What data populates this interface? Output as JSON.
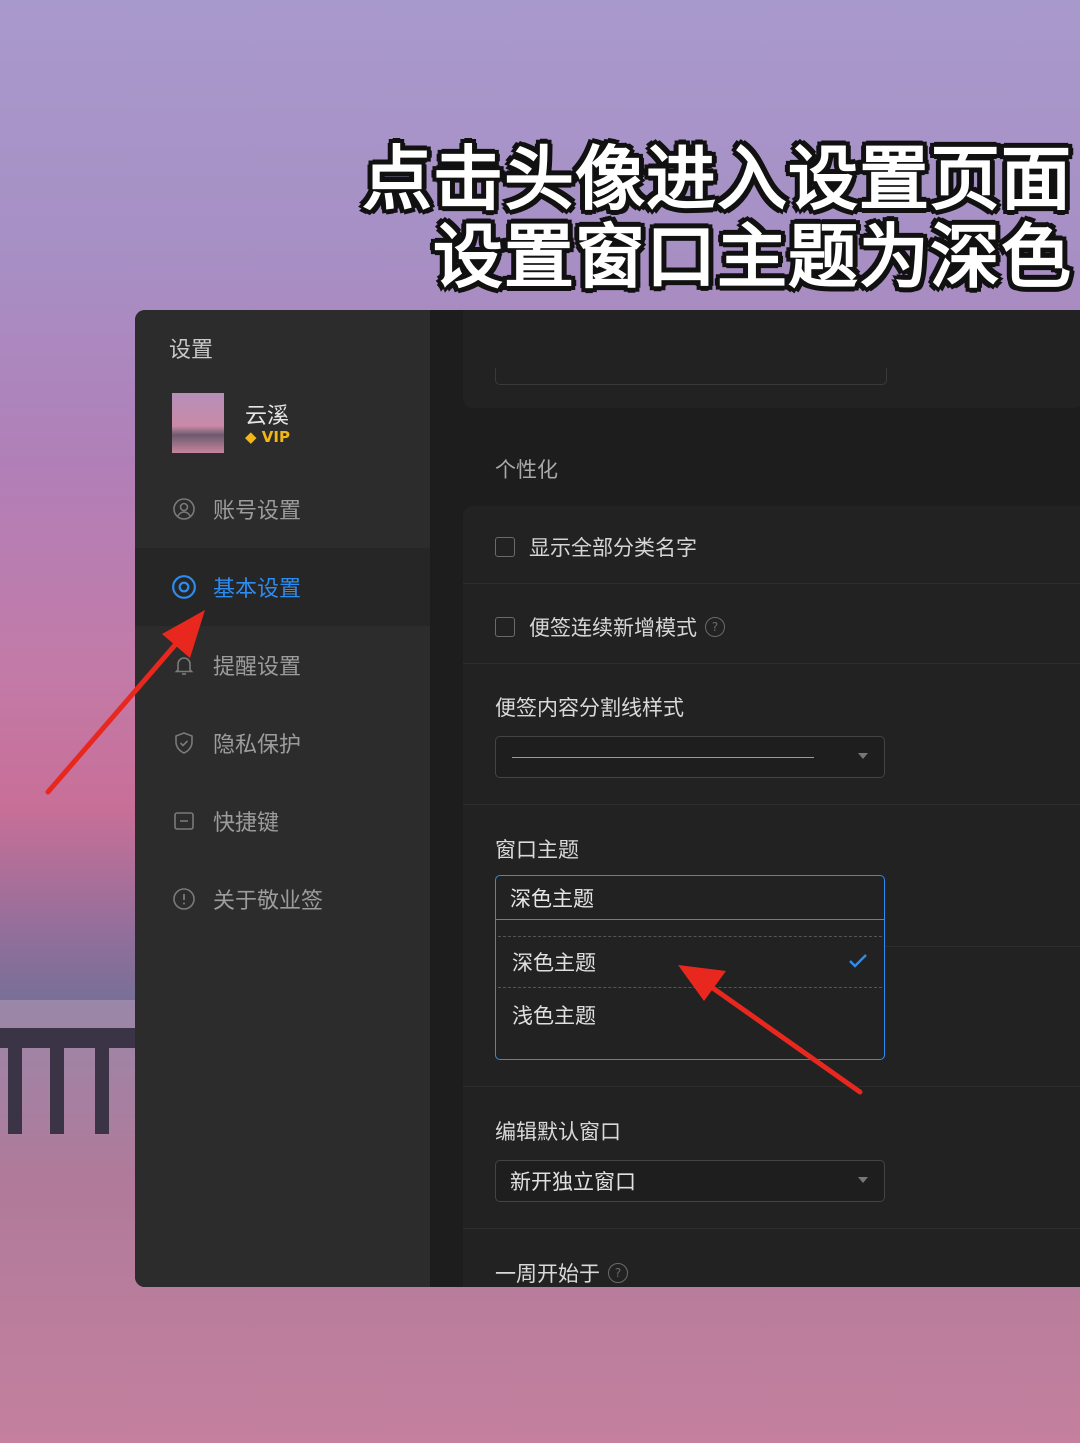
{
  "overlay": {
    "line1": "点击头像进入设置页面",
    "line2": "设置窗口主题为深色"
  },
  "sidebar": {
    "title": "设置",
    "user": {
      "name": "云溪",
      "badge": "VIP"
    },
    "items": [
      {
        "label": "账号设置",
        "icon": "user-icon"
      },
      {
        "label": "基本设置",
        "icon": "settings-icon",
        "active": true
      },
      {
        "label": "提醒设置",
        "icon": "bell-icon"
      },
      {
        "label": "隐私保护",
        "icon": "shield-icon"
      },
      {
        "label": "快捷键",
        "icon": "keyboard-icon"
      },
      {
        "label": "关于敬业签",
        "icon": "info-icon"
      }
    ]
  },
  "main": {
    "section_personalize": "个性化",
    "option_show_category_names": "显示全部分类名字",
    "option_continuous_add": "便签连续新增模式",
    "divider_style_label": "便签内容分割线样式",
    "window_theme_label": "窗口主题",
    "window_theme_value": "深色主题",
    "theme_options": [
      "深色主题",
      "浅色主题"
    ],
    "edit_default_window_label": "编辑默认窗口",
    "edit_default_window_value": "新开独立窗口",
    "week_start_label": "一周开始于"
  },
  "colors": {
    "accent": "#2d8cf0",
    "vip": "#f2b616",
    "arrow": "#e8281f"
  }
}
